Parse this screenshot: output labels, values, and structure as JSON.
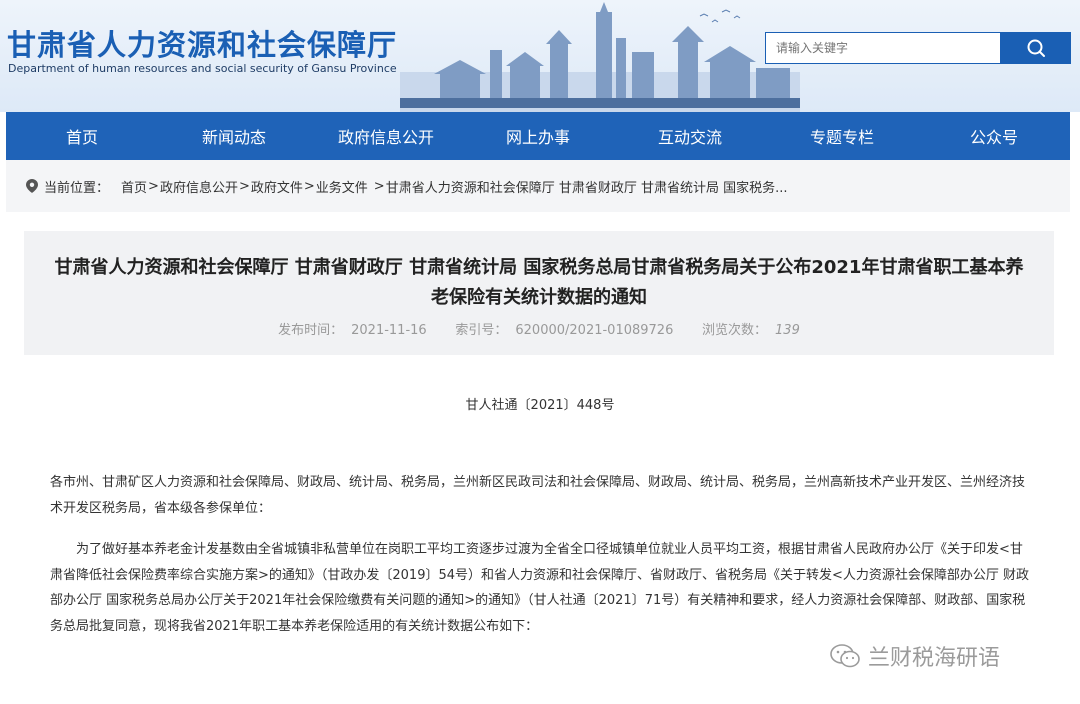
{
  "header": {
    "title_cn": "甘肃省人力资源和社会保障厅",
    "title_en": "Department of human resources and social security of Gansu Province",
    "search_placeholder": "请输入关键字"
  },
  "nav": {
    "items": [
      "首页",
      "新闻动态",
      "政府信息公开",
      "网上办事",
      "互动交流",
      "专题专栏",
      "公众号"
    ]
  },
  "breadcrumb": {
    "label": "当前位置：",
    "items": [
      "首页",
      "政府信息公开",
      "政府文件",
      "业务文件",
      "甘肃省人力资源和社会保障厅 甘肃省财政厅 甘肃省统计局 国家税务..."
    ]
  },
  "article": {
    "title": "甘肃省人力资源和社会保障厅 甘肃省财政厅 甘肃省统计局 国家税务总局甘肃省税务局关于公布2021年甘肃省职工基本养老保险有关统计数据的通知",
    "date_label": "发布时间：",
    "date": "2021-11-16",
    "index_label": "索引号：",
    "index": "620000/2021-01089726",
    "views_label": "浏览次数：",
    "views": "139",
    "doc_number": "甘人社通〔2021〕448号",
    "salutation": "各市州、甘肃矿区人力资源和社会保障局、财政局、统计局、税务局，兰州新区民政司法和社会保障局、财政局、统计局、税务局，兰州高新技术产业开发区、兰州经济技术开发区税务局，省本级各参保单位：",
    "paragraph1": "为了做好基本养老金计发基数由全省城镇非私营单位在岗职工平均工资逐步过渡为全省全口径城镇单位就业人员平均工资，根据甘肃省人民政府办公厅《关于印发<甘肃省降低社会保险费率综合实施方案>的通知》（甘政办发〔2019〕54号）和省人力资源和社会保障厅、省财政厅、省税务局《关于转发<人力资源社会保障部办公厅 财政部办公厅 国家税务总局办公厅关于2021年社会保险缴费有关问题的通知>的通知》（甘人社通〔2021〕71号）有关精神和要求，经人力资源社会保障部、财政部、国家税务总局批复同意，现将我省2021年职工基本养老保险适用的有关统计数据公布如下："
  },
  "watermark": {
    "text": "兰财税海研语"
  },
  "colors": {
    "brand_blue": "#1f63b8",
    "logo_blue": "#1a5fb4"
  }
}
